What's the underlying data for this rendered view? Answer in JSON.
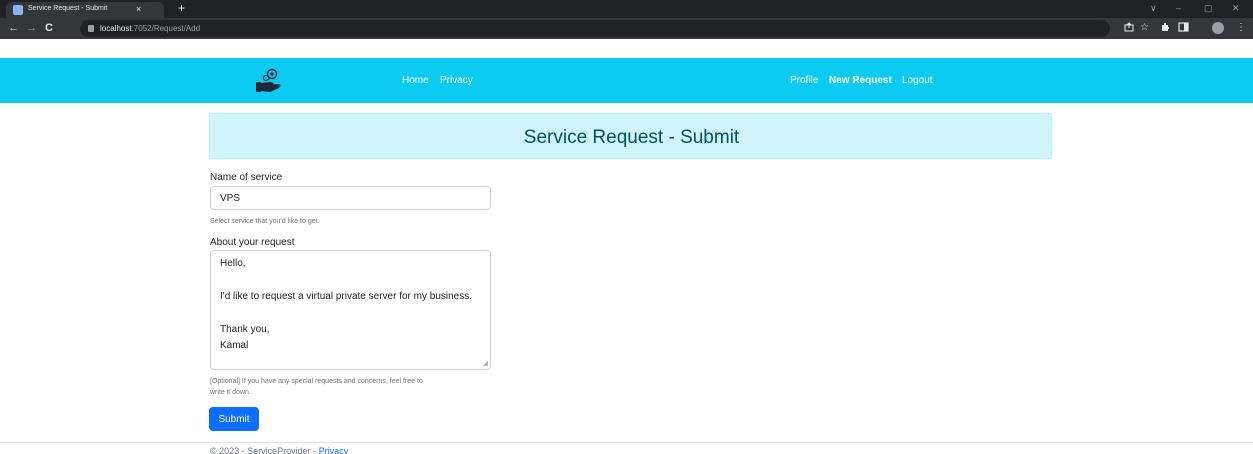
{
  "browser": {
    "tab_title": "Service Request - Submit",
    "tab_close": "×",
    "new_tab": "+",
    "url_host": "localhost",
    "url_path": ":7052/Request/Add",
    "back": "←",
    "forward": "→",
    "reload": "C",
    "window_controls": [
      "∨",
      "–",
      "▢",
      "✕"
    ]
  },
  "navbar": {
    "bg_color": "#0dcaf0",
    "logo_icon": "hand-gear-logo",
    "left_links": [
      "Home",
      "Privacy"
    ],
    "right_links": [
      "Profile",
      "New Request",
      "Logout"
    ],
    "active_link": "New Request"
  },
  "page": {
    "title": "Service Request - Submit",
    "service": {
      "label": "Name of service",
      "value": "VPS",
      "help": "Select service that you'd like to get."
    },
    "about": {
      "label": "About your request",
      "lines": [
        "Hello,",
        "",
        "I'd like to request a virtual private server for my business.",
        "",
        "Thank you,",
        "Kamal"
      ],
      "help_line1": "[Optional] If you have any special requests and concerns, feel free to",
      "help_line2": "write it down."
    },
    "submit_label": "Submit"
  },
  "footer": {
    "copyright": "© 2023 - ServiceProvider - ",
    "privacy_link": "Privacy"
  }
}
